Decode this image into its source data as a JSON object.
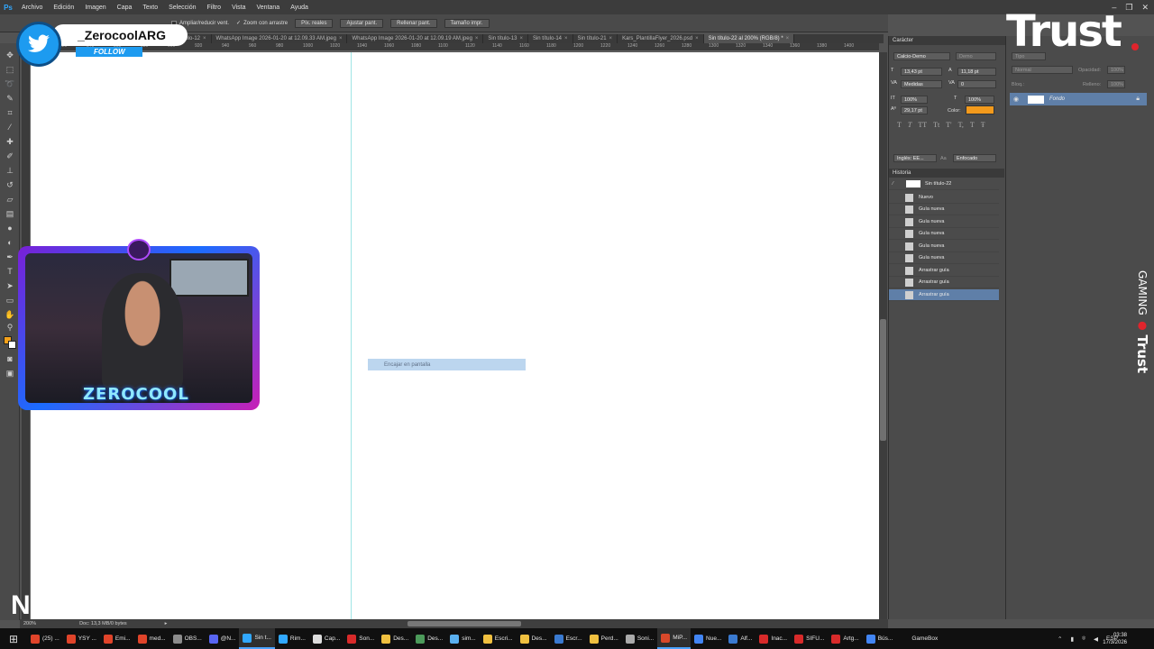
{
  "menubar": {
    "logo": "Ps",
    "items": [
      "Archivo",
      "Edición",
      "Imagen",
      "Capa",
      "Texto",
      "Selección",
      "Filtro",
      "Vista",
      "Ventana",
      "Ayuda"
    ]
  },
  "options_bar": {
    "check1": "Ampliar/reducir vent.",
    "check2": "Zoom con arrastre",
    "buttons": [
      "Píx. reales",
      "Ajustar pant.",
      "Rellenar pant.",
      "Tamaño impr."
    ]
  },
  "tabs": [
    {
      "label": "Sin título-12"
    },
    {
      "label": "WhatsApp Image 2026-01-20 at 12.09.33 AM.jpeg"
    },
    {
      "label": "WhatsApp Image 2026-01-20 at 12.09.19 AM.jpeg"
    },
    {
      "label": "Sin título-13"
    },
    {
      "label": "Sin título-14"
    },
    {
      "label": "Sin título-21"
    },
    {
      "label": "Kars_PlantillaFlyer_2026.psd"
    },
    {
      "label": "Sin título-22 al 200% (RGB/8) *"
    }
  ],
  "ruler": [
    "800",
    "820",
    "840",
    "860",
    "880",
    "900",
    "920",
    "940",
    "960",
    "980",
    "1000",
    "1020",
    "1040",
    "1060",
    "1080",
    "1100",
    "1120",
    "1140",
    "1160",
    "1180",
    "1200",
    "1220",
    "1240",
    "1260",
    "1280",
    "1300",
    "1320",
    "1340",
    "1360",
    "1380",
    "1400"
  ],
  "canvas": {
    "hint": "Encajar en pantalla"
  },
  "status": {
    "zoom": "200%",
    "doc": "Doc: 13,3 MB/0 bytes"
  },
  "character_panel": {
    "title": "Carácter",
    "font": "Calcio-Demo",
    "style": "Demo",
    "size": "13,43 pt",
    "leading": "11,18 pt",
    "kerning": "Medidas",
    "tracking": "0",
    "vscale": "100%",
    "hscale": "100%",
    "baseline": "29,17 pt",
    "color_label": "Color:",
    "color": "#f39a1c",
    "language": "Inglés: EE...",
    "antialias": "Enfocado",
    "aa_label": "Aa"
  },
  "history_panel": {
    "title": "Historia",
    "snapshot": "Sin título-22",
    "items": [
      "Nuevo",
      "Guía nueva",
      "Guía nueva",
      "Guía nueva",
      "Guía nueva",
      "Guía nueva",
      "Arrastrar guía",
      "Arrastrar guía",
      "Arrastrar guía"
    ]
  },
  "layers_panel": {
    "mode": "Normal",
    "opacity_label": "Opacidad:",
    "opacity": "100%",
    "fill_label": "Relleno:",
    "fill": "100%",
    "lock_label": "Bloq.:",
    "layer_name": "Fondo",
    "kind": "Tipo"
  },
  "overlays": {
    "twitter_handle": "_ZerocoolARG",
    "follow": "FOLLOW",
    "cam_title": "ZEROCOOL",
    "trust": "Trust",
    "gaming": "GAMING",
    "gaming_brand": "Trust",
    "corner_logo": "N"
  },
  "taskbar": {
    "items": [
      {
        "label": "(25) ...",
        "color": "#e0442a"
      },
      {
        "label": "YSY ...",
        "color": "#e0442a"
      },
      {
        "label": "Emi...",
        "color": "#e0442a"
      },
      {
        "label": "med...",
        "color": "#e0442a"
      },
      {
        "label": "OBS...",
        "color": "#8c8c8c"
      },
      {
        "label": "@N...",
        "color": "#5865f2"
      },
      {
        "label": "Sin t...",
        "color": "#31a8ff"
      },
      {
        "label": "Rim...",
        "color": "#31a8ff"
      },
      {
        "label": "Cap...",
        "color": "#dddddd"
      },
      {
        "label": "Son...",
        "color": "#d82a2a"
      },
      {
        "label": "Des...",
        "color": "#f0c040"
      },
      {
        "label": "Des...",
        "color": "#4c9a5a"
      },
      {
        "label": "sim...",
        "color": "#5ab0f0"
      },
      {
        "label": "Escri...",
        "color": "#f0c040"
      },
      {
        "label": "Des...",
        "color": "#f0c040"
      },
      {
        "label": "Escr...",
        "color": "#3a7ad0"
      },
      {
        "label": "Perd...",
        "color": "#f0c040"
      },
      {
        "label": "Soni...",
        "color": "#aaaaaa"
      },
      {
        "label": "MiP...",
        "color": "#d8482a"
      },
      {
        "label": "Nue...",
        "color": "#4285f4"
      },
      {
        "label": "Alf...",
        "color": "#3a7ad0"
      },
      {
        "label": "Inac...",
        "color": "#d82a2a"
      },
      {
        "label": "SIFU...",
        "color": "#d82a2a"
      },
      {
        "label": "Artg...",
        "color": "#d82a2a"
      },
      {
        "label": "Bús...",
        "color": "#4285f4"
      },
      {
        "label": "GameBox",
        "color": "#101010"
      }
    ],
    "lang": "ESP",
    "time": "03:38",
    "date": "17/3/2026"
  }
}
